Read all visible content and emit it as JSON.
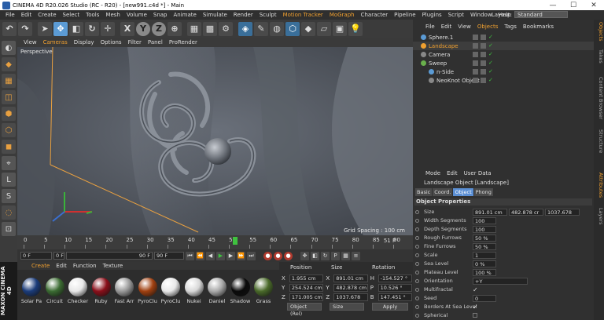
{
  "app": {
    "title": "CINEMA 4D R20.026 Studio (RC - R20) - [new991.c4d *] - Main",
    "minimize": "—",
    "maximize": "☐",
    "close": "✕"
  },
  "menu": {
    "items": [
      "File",
      "Edit",
      "Create",
      "Select",
      "Tools",
      "Mesh",
      "Volume",
      "Snap",
      "Animate",
      "Simulate",
      "Render",
      "Sculpt",
      "Motion Tracker",
      "MoGraph",
      "Character",
      "Pipeline",
      "Plugins",
      "Script",
      "Window",
      "Help"
    ],
    "highlighted": [
      "Motion Tracker",
      "MoGraph"
    ],
    "layout_label": "Layout:",
    "layout_value": "Standard"
  },
  "viewport": {
    "menu": [
      "View",
      "Cameras",
      "Display",
      "Options",
      "Filter",
      "Panel",
      "ProRender"
    ],
    "active_menu": "Cameras",
    "label": "Perspective",
    "grid_spacing": "Grid Spacing : 100 cm"
  },
  "timeline": {
    "ticks": [
      "0",
      "5",
      "10",
      "15",
      "20",
      "25",
      "30",
      "35",
      "40",
      "45",
      "50",
      "55",
      "60",
      "65",
      "70",
      "75",
      "80",
      "85",
      "90"
    ],
    "current": "51",
    "end_marker": "51 F",
    "playhead_fraction": 0.567
  },
  "time_controls": {
    "start": "0 F",
    "current": "0 F",
    "end_preview": "90 F",
    "end": "90 F"
  },
  "material": {
    "menu": [
      "Create",
      "Edit",
      "Function",
      "Texture"
    ],
    "active_menu": "Create",
    "items": [
      {
        "name": "Solar Pa",
        "color": "#1b3c7a"
      },
      {
        "name": "Circuit",
        "color": "#3b6b32"
      },
      {
        "name": "Checker",
        "color": "#e8e8e8"
      },
      {
        "name": "Ruby",
        "color": "#8a0f1a"
      },
      {
        "name": "Fast Arr",
        "color": "#999999"
      },
      {
        "name": "PyroClu",
        "color": "#a04010"
      },
      {
        "name": "PyroClu",
        "color": "#e8e8e8"
      },
      {
        "name": "Nukei",
        "color": "#d8d8d8"
      },
      {
        "name": "Daniel",
        "color": "#aaaaaa"
      },
      {
        "name": "Shadow",
        "color": "#0a0a0a"
      },
      {
        "name": "Grass",
        "color": "#4a6a2a"
      }
    ],
    "brand": "MAXON CINEMA 4D"
  },
  "coordinates": {
    "headers": [
      "Position",
      "Size",
      "Rotation"
    ],
    "rows": [
      {
        "axis": "X",
        "pos": "1.955 cm",
        "size": "891.01 cm",
        "rot_label": "H",
        "rot": "-154.527 °"
      },
      {
        "axis": "Y",
        "pos": "254.524 cm",
        "size": "482.878 cm",
        "rot_label": "P",
        "rot": "10.526 °"
      },
      {
        "axis": "Z",
        "pos": "171.005 cm",
        "size": "1037.678 cm",
        "rot_label": "B",
        "rot": "147.451 °"
      }
    ],
    "mode": "Object (Rel)",
    "size_mode": "Size",
    "apply": "Apply"
  },
  "objects": {
    "menu": [
      "File",
      "Edit",
      "View",
      "Objects",
      "Tags",
      "Bookmarks"
    ],
    "active_menu": "Objects",
    "items": [
      {
        "name": "Sphere.1",
        "indent": 0,
        "color": "#5b9bd5",
        "selected": false
      },
      {
        "name": "Landscape",
        "indent": 0,
        "color": "#f0a030",
        "selected": true
      },
      {
        "name": "Camera",
        "indent": 0,
        "color": "#888888",
        "selected": false
      },
      {
        "name": "Sweep",
        "indent": 0,
        "color": "#6ab04c",
        "selected": false
      },
      {
        "name": "n-Side",
        "indent": 1,
        "color": "#5b9bd5",
        "selected": false
      },
      {
        "name": "NeoKnot Object",
        "indent": 1,
        "color": "#888888",
        "selected": false
      }
    ]
  },
  "side_tabs": [
    "Objects",
    "Takes",
    "Content Browser",
    "Structure",
    "Attributes",
    "Layers"
  ],
  "side_tab_active": [
    "Objects",
    "Attributes"
  ],
  "attributes": {
    "menu": [
      "Mode",
      "Edit",
      "User Data"
    ],
    "title": "Landscape Object [Landscape]",
    "tabs": [
      "Basic",
      "Coord.",
      "Object",
      "Phong"
    ],
    "active_tab": "Object",
    "section": "Object Properties",
    "props": [
      {
        "label": "Size",
        "values": [
          "891.01 cm",
          "482.878 cr",
          "1037.678"
        ]
      },
      {
        "label": "Width Segments",
        "values": [
          "100"
        ]
      },
      {
        "label": "Depth Segments",
        "values": [
          "100"
        ]
      },
      {
        "label": "Rough Furrows",
        "values": [
          "50 %"
        ]
      },
      {
        "label": "Fine Furrows",
        "values": [
          "50 %"
        ]
      },
      {
        "label": "Scale",
        "values": [
          "1"
        ]
      },
      {
        "label": "Sea Level",
        "values": [
          "0 %"
        ]
      },
      {
        "label": "Plateau Level",
        "values": [
          "100 %"
        ]
      },
      {
        "label": "Orientation",
        "values": [
          "+Y"
        ]
      },
      {
        "label": "Multifractal",
        "check": "✓"
      },
      {
        "label": "Seed",
        "values": [
          "0"
        ]
      },
      {
        "label": "Borders At Sea Level",
        "check": "✓"
      },
      {
        "label": "Spherical",
        "check": ""
      }
    ]
  }
}
